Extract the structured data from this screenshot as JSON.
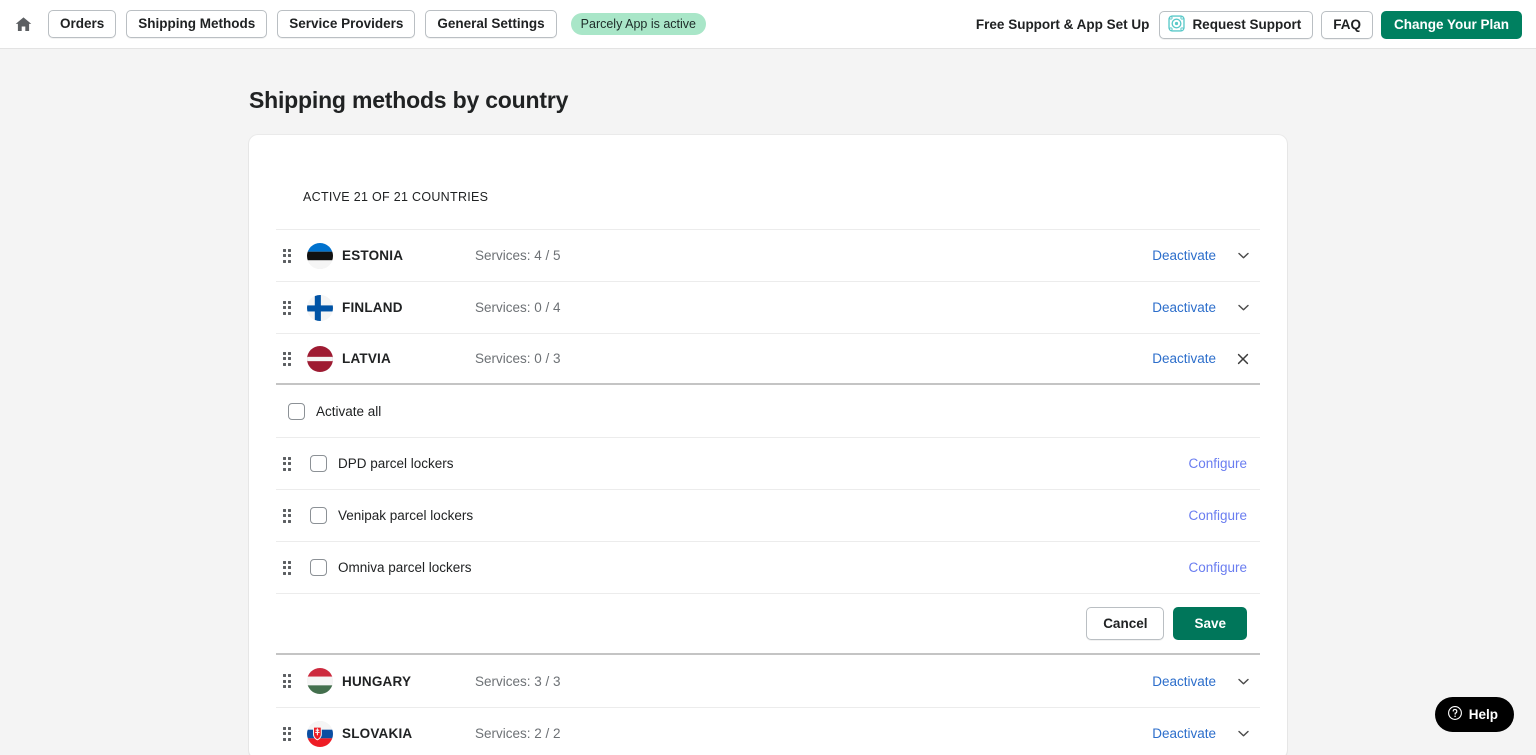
{
  "topbar": {
    "home_icon": "home-icon",
    "nav_buttons": [
      {
        "label": "Orders"
      },
      {
        "label": "Shipping Methods"
      },
      {
        "label": "Service Providers"
      },
      {
        "label": "General Settings"
      }
    ],
    "status_badge": "Parcely App is active",
    "support_label": "Free Support & App Set Up",
    "request_support_label": "Request Support",
    "request_support_icon": "support-target-icon",
    "faq_label": "FAQ",
    "change_plan_label": "Change Your Plan"
  },
  "page": {
    "title": "Shipping methods by country",
    "section_label": "ACTIVE 21 OF 21 COUNTRIES"
  },
  "countries": [
    {
      "name": "ESTONIA",
      "flag": "flag-estonia",
      "services": "Services: 4 / 5",
      "action_label": "Deactivate",
      "toggle_icon": "chevron-down-icon",
      "expanded": false
    },
    {
      "name": "FINLAND",
      "flag": "flag-finland",
      "services": "Services: 0 / 4",
      "action_label": "Deactivate",
      "toggle_icon": "chevron-down-icon",
      "expanded": false
    },
    {
      "name": "LATVIA",
      "flag": "flag-latvia",
      "services": "Services: 0 / 3",
      "action_label": "Deactivate",
      "toggle_icon": "close-icon",
      "expanded": true
    },
    {
      "name": "HUNGARY",
      "flag": "flag-hungary",
      "services": "Services: 3 / 3",
      "action_label": "Deactivate",
      "toggle_icon": "chevron-down-icon",
      "expanded": false
    },
    {
      "name": "SLOVAKIA",
      "flag": "flag-slovakia",
      "services": "Services: 2 / 2",
      "action_label": "Deactivate",
      "toggle_icon": "chevron-down-icon",
      "expanded": false
    }
  ],
  "expanded_panel": {
    "activate_all_label": "Activate all",
    "activate_all_checked": false,
    "services": [
      {
        "label": "DPD parcel lockers",
        "checked": false,
        "configure_label": "Configure"
      },
      {
        "label": "Venipak parcel lockers",
        "checked": false,
        "configure_label": "Configure"
      },
      {
        "label": "Omniva parcel lockers",
        "checked": false,
        "configure_label": "Configure"
      }
    ],
    "cancel_label": "Cancel",
    "save_label": "Save"
  },
  "help_widget": {
    "label": "Help",
    "icon": "question-circle-icon"
  },
  "colors": {
    "primary_green": "#008060",
    "save_green": "#00765a",
    "link_blue": "#2c6ecb",
    "configure_blue": "#6a7df0",
    "badge_green": "#a9e6c8",
    "page_bg": "#f4f4f4"
  }
}
